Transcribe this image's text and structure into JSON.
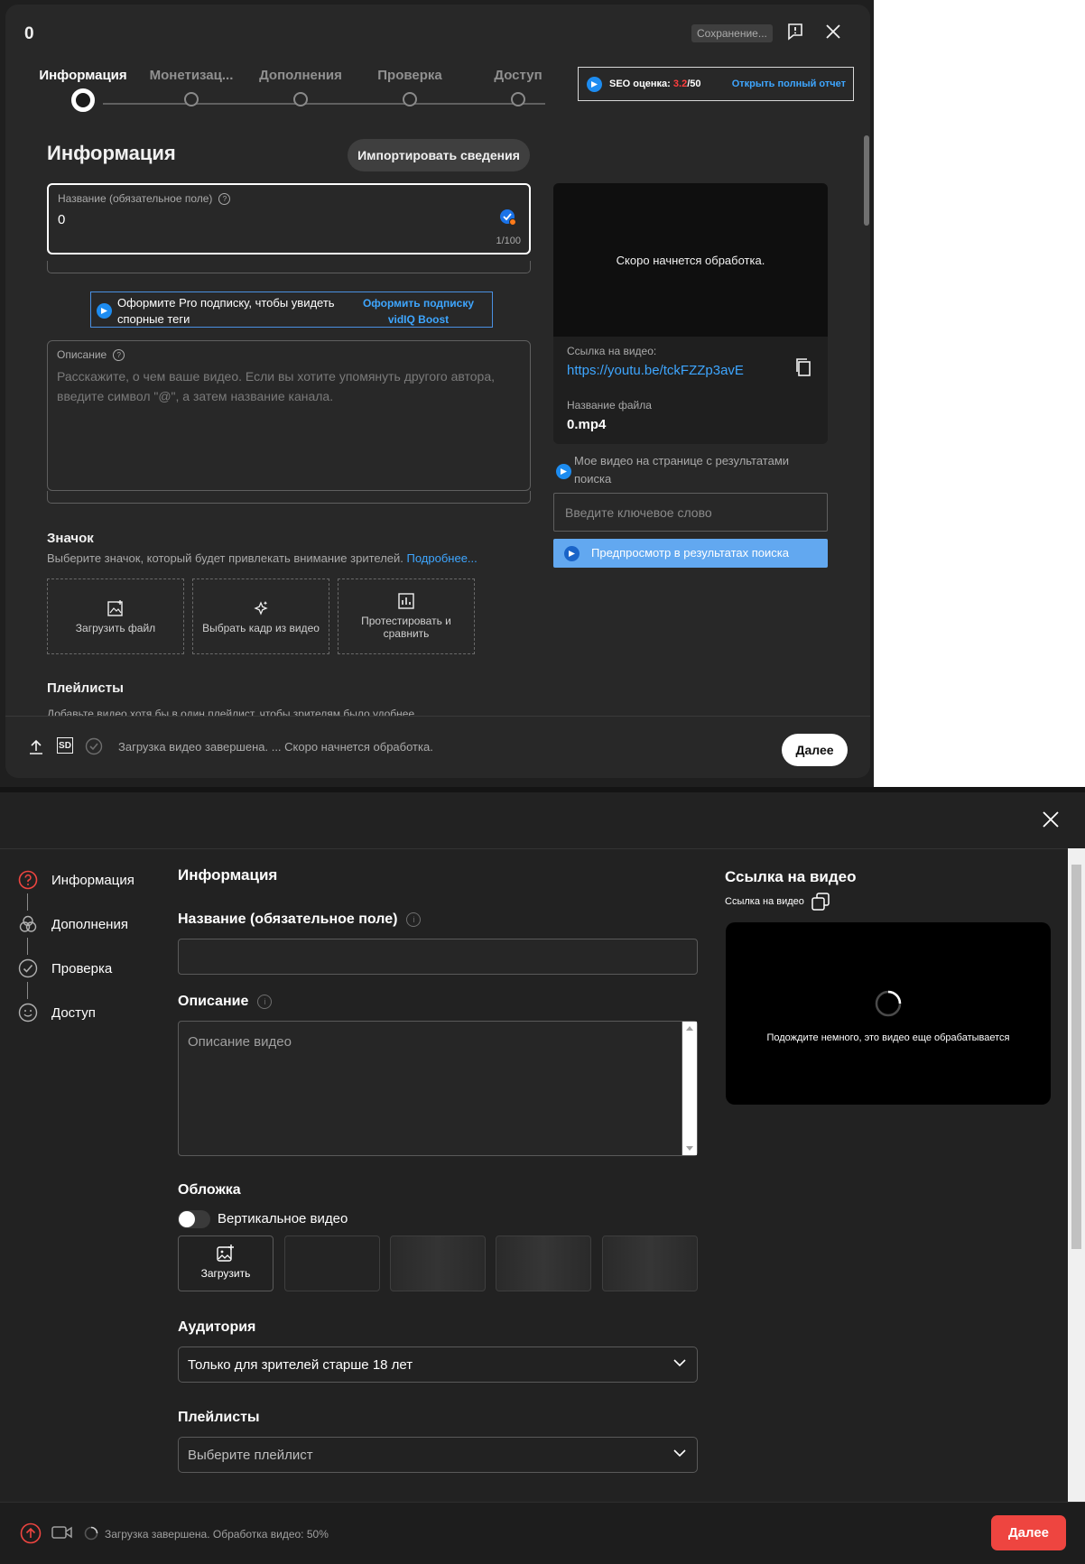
{
  "youtube": {
    "title": "0",
    "saving_label": "Сохранение...",
    "steps": [
      {
        "label": "Информация",
        "active": true
      },
      {
        "label": "Монетизац...",
        "active": false
      },
      {
        "label": "Дополнения",
        "active": false
      },
      {
        "label": "Проверка",
        "active": false
      },
      {
        "label": "Доступ",
        "active": false
      }
    ],
    "seo": {
      "label": "SEO оценка:",
      "score": "3.2",
      "max": "/50",
      "report_link": "Открыть полный отчет"
    },
    "section_title": "Информация",
    "import_button": "Импортировать сведения",
    "title_field": {
      "label": "Название (обязательное поле)",
      "value": "0",
      "counter": "1/100"
    },
    "pro_banner": {
      "text": "Оформите Pro подписку, чтобы увидеть спорные теги",
      "link": "Оформить подписку vidIQ Boost"
    },
    "description_field": {
      "label": "Описание",
      "placeholder": "Расскажите, о чем ваше видео. Если вы хотите упомянуть другого автора, введите символ \"@\", а затем название канала."
    },
    "preview": {
      "processing_text": "Скоро начнется обработка.",
      "link_label": "Ссылка на видео:",
      "link": "https://youtu.be/tckFZZp3avE",
      "filename_label": "Название файла",
      "filename": "0.mp4"
    },
    "search_preview_hint": "Мое видео на странице с результатами поиска",
    "keyword_placeholder": "Введите ключевое слово",
    "search_preview_button": "Предпросмотр в результатах поиска",
    "thumbnail": {
      "title": "Значок",
      "subtitle": "Выберите значок, который будет привлекать внимание зрителей.",
      "more_link": "Подробнее...",
      "options": [
        "Загрузить файл",
        "Выбрать кадр из видео",
        "Протестировать и сравнить"
      ]
    },
    "playlists": {
      "title": "Плейлисты",
      "subtitle": "Добавьте видео хотя бы в один плейлист, чтобы зрителям было удобнее"
    },
    "footer": {
      "quality_badge": "SD",
      "status": "Загрузка видео завершена. ... Скоро начнется обработка.",
      "next_button": "Далее"
    },
    "accent_color": "#3ea6ff"
  },
  "second": {
    "nav": [
      {
        "label": "Информация",
        "icon": "question-circle-icon",
        "active": true
      },
      {
        "label": "Дополнения",
        "icon": "circles-icon",
        "active": false
      },
      {
        "label": "Проверка",
        "icon": "check-circle-icon",
        "active": false
      },
      {
        "label": "Доступ",
        "icon": "smile-icon",
        "active": false
      }
    ],
    "section_title": "Информация",
    "title_label": "Название (обязательное поле)",
    "description_label": "Описание",
    "description_placeholder": "Описание видео",
    "cover_title": "Обложка",
    "vertical_label": "Вертикальное видео",
    "vertical_enabled": false,
    "upload_label": "Загрузить",
    "audience_title": "Аудитория",
    "audience_value": "Только для зрителей старше 18 лет",
    "playlists_title": "Плейлисты",
    "playlists_placeholder": "Выберите плейлист",
    "link_title": "Ссылка на видео",
    "link_label": "Ссылка на видео",
    "wait_text": "Подождите немного, это видео еще обрабатывается",
    "status": "Загрузка завершена. Обработка видео: 50%",
    "next_button": "Далее",
    "accent_color": "#ee4540"
  }
}
